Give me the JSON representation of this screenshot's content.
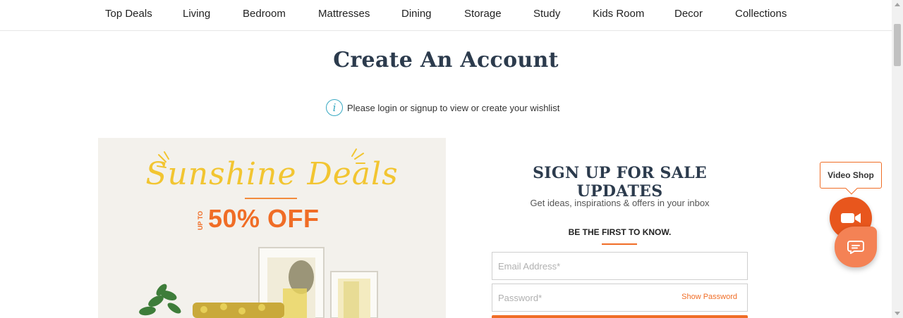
{
  "nav": {
    "items": [
      "Top Deals",
      "Living",
      "Bedroom",
      "Mattresses",
      "Dining",
      "Storage",
      "Study",
      "Kids Room",
      "Decor",
      "Collections"
    ]
  },
  "page": {
    "title": "Create An Account",
    "info_text": "Please login or signup to view or create your wishlist",
    "info_icon": "i"
  },
  "banner": {
    "script_title": "Sunshine Deals",
    "upto": "UP TO",
    "offer": "50% OFF"
  },
  "signup": {
    "title": "SIGN UP FOR SALE UPDATES",
    "subtitle": "Get ideas, inspirations & offers in your inbox",
    "kicker": "BE THE FIRST TO KNOW.",
    "email_placeholder": "Email Address*",
    "password_placeholder": "Password*",
    "show_password": "Show Password"
  },
  "widgets": {
    "video_label": "Video Shop"
  },
  "colors": {
    "accent": "#f06d26",
    "heading": "#2c3b4d",
    "info": "#37a8c2",
    "banner_yellow": "#f2c531"
  }
}
